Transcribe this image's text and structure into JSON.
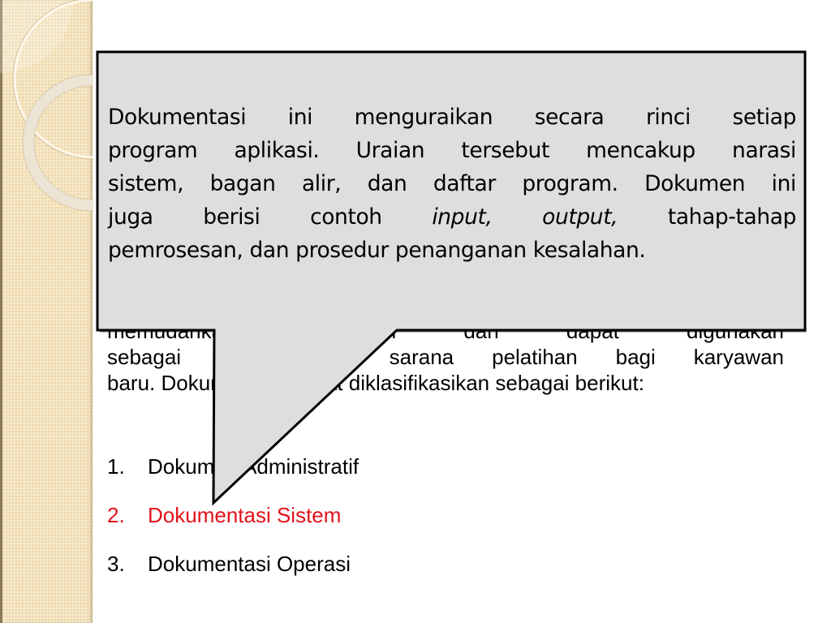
{
  "slide": {
    "background": "#ffffff",
    "sidebar_color": "#f3e2bb",
    "body": {
      "lines": [
        "memudahkan modifikasi dan dapat digunakan",
        "sebagai bahan dan sarana pelatihan bagi karyawan",
        "baru. Dokumentasi dapat diklasifikasikan sebagai berikut:"
      ]
    },
    "list": {
      "items": [
        {
          "number": "1.",
          "label": "Dokumen Administratif",
          "highlight": false
        },
        {
          "number": "2.",
          "label": "Dokumentasi Sistem",
          "highlight": true
        },
        {
          "number": "3.",
          "label": "Dokumentasi Operasi",
          "highlight": false
        }
      ],
      "highlight_color": "#e3131b"
    },
    "callout": {
      "fill_color": "#dedede",
      "border_color": "#000000",
      "lines": [
        {
          "text": "Dokumentasi ini menguraikan secara rinci setiap"
        },
        {
          "text": "program aplikasi. Uraian tersebut mencakup narasi"
        },
        {
          "text": "sistem, bagan alir, dan daftar program. Dokumen ini"
        },
        {
          "pre": "juga berisi contoh ",
          "italic1": "input,",
          "mid": " ",
          "italic2": "output,",
          "post": " tahap-tahap"
        },
        {
          "text": "pemrosesan, dan prosedur penanganan kesalahan."
        }
      ]
    }
  }
}
